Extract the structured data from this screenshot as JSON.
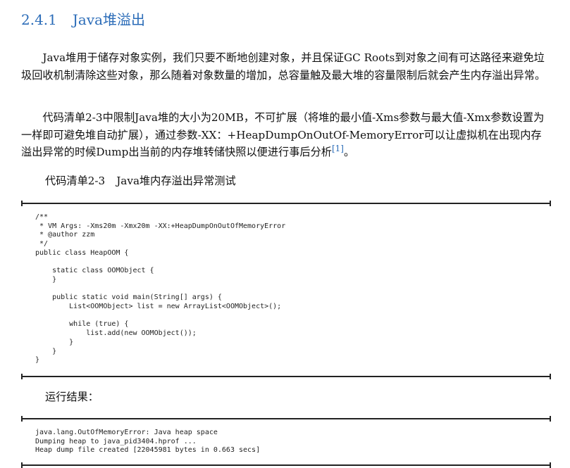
{
  "section": {
    "number": "2.4.1",
    "title": "Java堆溢出"
  },
  "paragraphs": [
    {
      "text": "Java堆用于储存对象实例，我们只要不断地创建对象，并且保证GC Roots到对象之间有可达路径来避免垃圾回收机制清除这些对象，那么随着对象数量的增加，总容量触及最大堆的容量限制后就会产生内存溢出异常。"
    },
    {
      "text": "代码清单2-3中限制Java堆的大小为20MB，不可扩展（将堆的最小值-Xms参数与最大值-Xmx参数设置为一样即可避免堆自动扩展），通过参数-XX：+HeapDumpOnOutOf-MemoryError可以让虚拟机在出现内存溢出异常的时候Dump出当前的内存堆转储快照以便进行事后分析",
      "footnote": "[1]",
      "tail": "。"
    }
  ],
  "listing": {
    "label": "代码清单2-3",
    "title": "Java堆内存溢出异常测试"
  },
  "code_lines": [
    "/**",
    " * VM Args: -Xms20m -Xmx20m -XX:+HeapDumpOnOutOfMemoryError",
    " * @author zzm",
    " */",
    "public class HeapOOM {",
    "",
    "    static class OOMObject {",
    "    }",
    "",
    "    public static void main(String[] args) {",
    "        List<OOMObject> list = new ArrayList<OOMObject>();",
    "",
    "        while (true) {",
    "            list.add(new OOMObject());",
    "        }",
    "    }",
    "}"
  ],
  "result": {
    "label": "运行结果：",
    "lines": [
      "java.lang.OutOfMemoryError: Java heap space",
      "Dumping heap to java_pid3404.hprof ...",
      "Heap dump file created [22045981 bytes in 0.663 secs]"
    ]
  }
}
